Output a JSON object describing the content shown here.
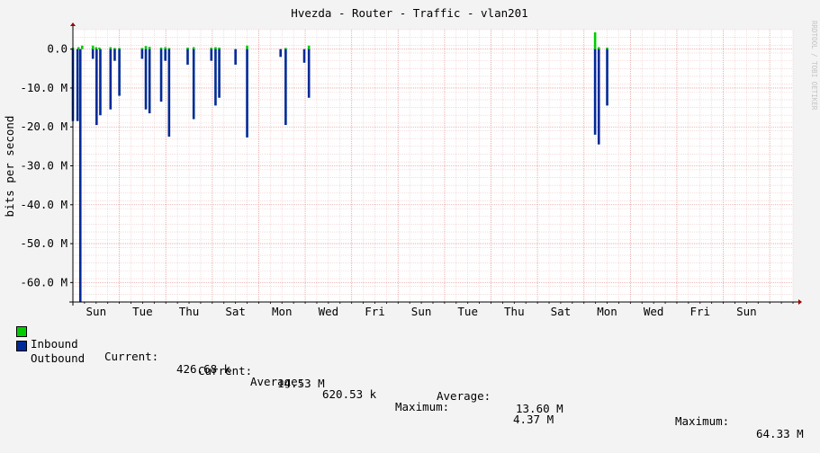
{
  "chart_data": {
    "type": "area",
    "title": "Hvezda - Router - Traffic - vlan201",
    "ylabel": "bits per second",
    "watermark": "RRDTOOL / TOBI OETIKER",
    "ylim": [
      -65000000,
      5000000
    ],
    "yticks": [
      {
        "value": 0,
        "label": "0.0"
      },
      {
        "value": -10000000,
        "label": "-10.0 M"
      },
      {
        "value": -20000000,
        "label": "-20.0 M"
      },
      {
        "value": -30000000,
        "label": "-30.0 M"
      },
      {
        "value": -40000000,
        "label": "-40.0 M"
      },
      {
        "value": -50000000,
        "label": "-50.0 M"
      },
      {
        "value": -60000000,
        "label": "-60.0 M"
      }
    ],
    "xlim": [
      0,
      15.5
    ],
    "xticks": [
      {
        "value": 0.5,
        "label": "Sun"
      },
      {
        "value": 1.5,
        "label": "Tue"
      },
      {
        "value": 2.5,
        "label": "Thu"
      },
      {
        "value": 3.5,
        "label": "Sat"
      },
      {
        "value": 4.5,
        "label": "Mon"
      },
      {
        "value": 5.5,
        "label": "Wed"
      },
      {
        "value": 6.5,
        "label": "Fri"
      },
      {
        "value": 7.5,
        "label": "Sun"
      },
      {
        "value": 8.5,
        "label": "Tue"
      },
      {
        "value": 9.5,
        "label": "Thu"
      },
      {
        "value": 10.5,
        "label": "Sat"
      },
      {
        "value": 11.5,
        "label": "Mon"
      },
      {
        "value": 12.5,
        "label": "Wed"
      },
      {
        "value": 13.5,
        "label": "Fri"
      },
      {
        "value": 14.5,
        "label": "Sun"
      }
    ],
    "series": [
      {
        "name": "Inbound",
        "color": "#00cc00",
        "points": [
          {
            "x": 0.0,
            "y": 400000
          },
          {
            "x": 0.12,
            "y": 500000
          },
          {
            "x": 0.2,
            "y": 900000
          },
          {
            "x": 0.43,
            "y": 900000
          },
          {
            "x": 0.5,
            "y": 500000
          },
          {
            "x": 0.57,
            "y": 400000
          },
          {
            "x": 0.81,
            "y": 500000
          },
          {
            "x": 0.9,
            "y": 300000
          },
          {
            "x": 1.0,
            "y": 300000
          },
          {
            "x": 1.49,
            "y": 300000
          },
          {
            "x": 1.57,
            "y": 800000
          },
          {
            "x": 1.65,
            "y": 600000
          },
          {
            "x": 1.9,
            "y": 400000
          },
          {
            "x": 1.99,
            "y": 500000
          },
          {
            "x": 2.07,
            "y": 300000
          },
          {
            "x": 2.47,
            "y": 400000
          },
          {
            "x": 2.6,
            "y": 500000
          },
          {
            "x": 2.98,
            "y": 400000
          },
          {
            "x": 3.07,
            "y": 500000
          },
          {
            "x": 3.15,
            "y": 400000
          },
          {
            "x": 3.75,
            "y": 900000
          },
          {
            "x": 4.58,
            "y": 300000
          },
          {
            "x": 5.08,
            "y": 900000
          },
          {
            "x": 11.24,
            "y": 4300000
          },
          {
            "x": 11.32,
            "y": 500000
          },
          {
            "x": 11.5,
            "y": 400000
          }
        ]
      },
      {
        "name": "Outbound",
        "color": "#002a97",
        "points": [
          {
            "x": 0.0,
            "y": -18500000
          },
          {
            "x": 0.1,
            "y": -18500000
          },
          {
            "x": 0.16,
            "y": -65000000
          },
          {
            "x": 0.43,
            "y": -2500000
          },
          {
            "x": 0.51,
            "y": -19500000
          },
          {
            "x": 0.59,
            "y": -17000000
          },
          {
            "x": 0.81,
            "y": -15500000
          },
          {
            "x": 0.9,
            "y": -3000000
          },
          {
            "x": 1.0,
            "y": -12000000
          },
          {
            "x": 1.49,
            "y": -2500000
          },
          {
            "x": 1.57,
            "y": -15500000
          },
          {
            "x": 1.65,
            "y": -16500000
          },
          {
            "x": 1.9,
            "y": -13500000
          },
          {
            "x": 1.99,
            "y": -3000000
          },
          {
            "x": 2.07,
            "y": -22500000
          },
          {
            "x": 2.47,
            "y": -4000000
          },
          {
            "x": 2.6,
            "y": -18000000
          },
          {
            "x": 2.98,
            "y": -3000000
          },
          {
            "x": 3.07,
            "y": -14500000
          },
          {
            "x": 3.15,
            "y": -12500000
          },
          {
            "x": 3.5,
            "y": -4000000
          },
          {
            "x": 3.75,
            "y": -22700000
          },
          {
            "x": 4.47,
            "y": -2000000
          },
          {
            "x": 4.58,
            "y": -19500000
          },
          {
            "x": 4.98,
            "y": -3500000
          },
          {
            "x": 5.08,
            "y": -12500000
          },
          {
            "x": 11.24,
            "y": -22000000
          },
          {
            "x": 11.32,
            "y": -24500000
          },
          {
            "x": 11.5,
            "y": -14500000
          }
        ]
      }
    ],
    "legend": [
      {
        "name": "Inbound",
        "current_label": "Current:",
        "current": "426.68 k",
        "average_label": "Average:",
        "average": "620.53 k",
        "maximum_label": "Maximum:",
        "maximum": "4.37 M"
      },
      {
        "name": "Outbound",
        "current_label": "Current:",
        "current": "14.53 M",
        "average_label": "Average:",
        "average": "13.60 M",
        "maximum_label": "Maximum:",
        "maximum": "64.33 M"
      }
    ]
  }
}
